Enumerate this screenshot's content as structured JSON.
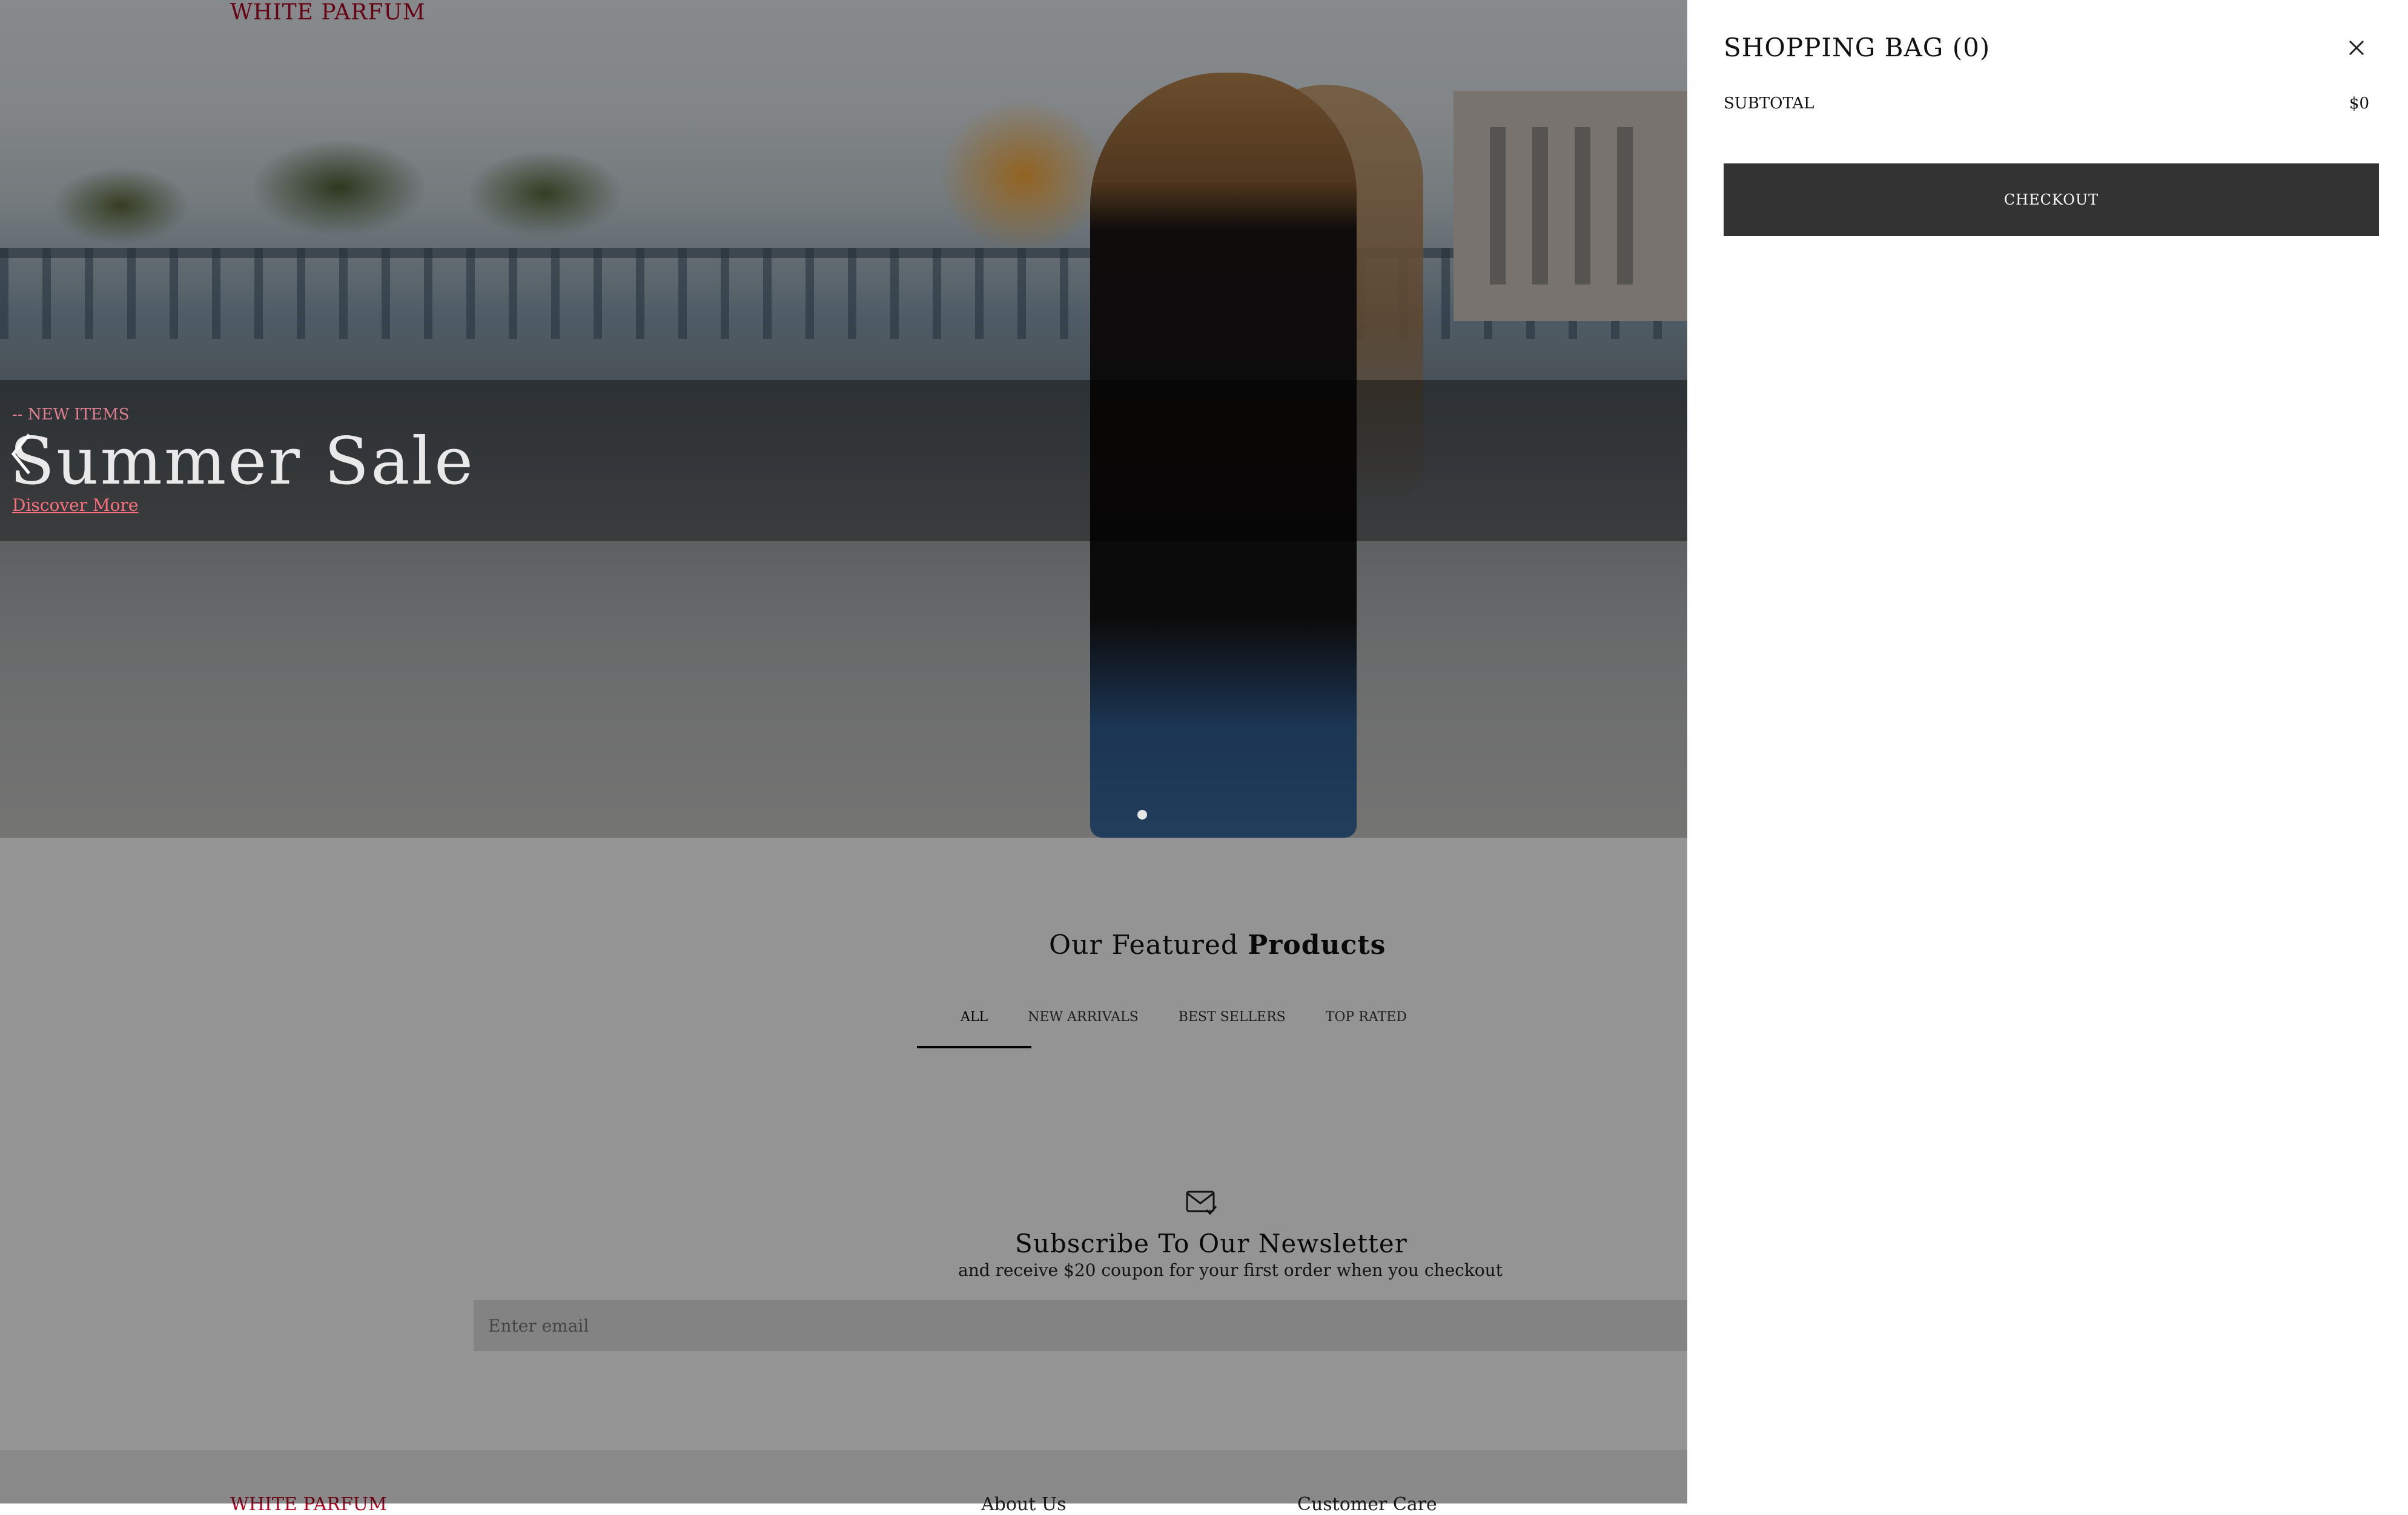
{
  "header": {
    "logo": "WHITE PARFUM"
  },
  "hero": {
    "subtitle": "-- NEW ITEMS",
    "title": "Summer Sale",
    "cta": "Discover More"
  },
  "featured": {
    "title_regular": "Our Featured",
    "title_bold": "Products",
    "tabs": [
      "ALL",
      "NEW ARRIVALS",
      "BEST SELLERS",
      "TOP RATED"
    ],
    "active_tab": "ALL"
  },
  "newsletter": {
    "title": "Subscribe To Our Newsletter",
    "subtitle": "and receive $20 coupon for your first order when you checkout",
    "email_placeholder": "Enter email"
  },
  "footer": {
    "logo": "WHITE PARFUM",
    "about": "About Us",
    "customer_care": "Customer Care"
  },
  "cart": {
    "title": "SHOPPING BAG (0)",
    "subtotal_label": "SUBTOTAL",
    "subtotal_value": "$0",
    "checkout_label": "CHECKOUT"
  },
  "icons": {
    "close": "close-icon",
    "mail": "mail-check-icon",
    "prev": "chevron-left-icon"
  }
}
